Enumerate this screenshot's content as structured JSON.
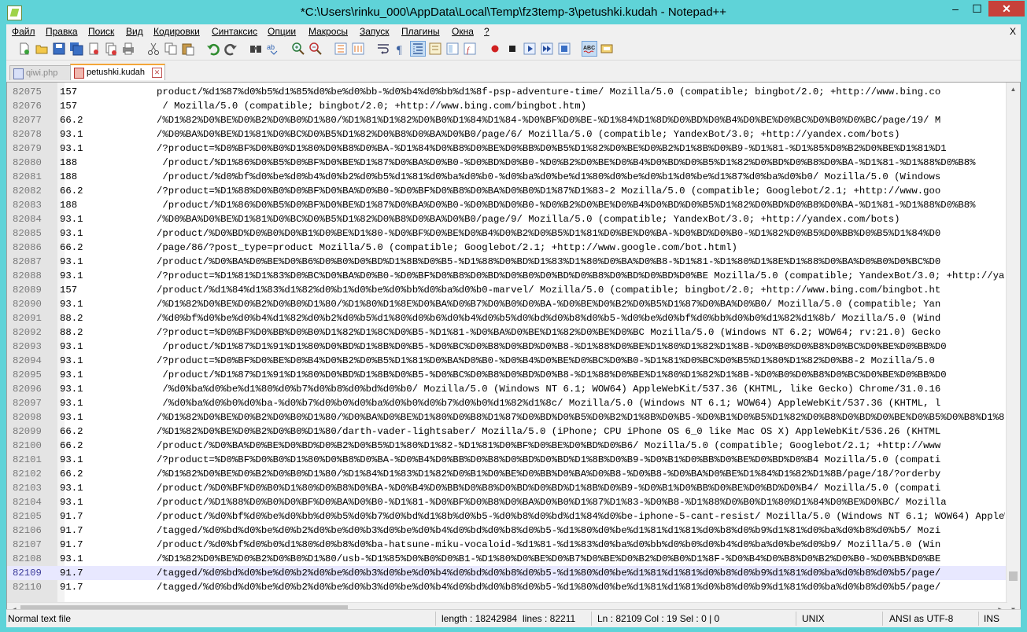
{
  "window": {
    "title": "*C:\\Users\\rinku_000\\AppData\\Local\\Temp\\fz3temp-3\\petushki.kudah - Notepad++",
    "minimize": "–",
    "maximize": "☐",
    "close": "✕"
  },
  "menu": {
    "items": [
      "Файл",
      "Правка",
      "Поиск",
      "Вид",
      "Кодировки",
      "Синтаксис",
      "Опции",
      "Макросы",
      "Запуск",
      "Плагины",
      "Окна",
      "?"
    ],
    "close": "X"
  },
  "tabs": [
    {
      "label": "qiwi.php",
      "active": false
    },
    {
      "label": "petushki.kudah",
      "active": true
    }
  ],
  "editor": {
    "current_line": "82109",
    "lines": [
      {
        "n": "82075",
        "c": "157",
        "t": "product/%d1%87%d0%b5%d1%85%d0%be%d0%bb-%d0%b4%d0%bb%d1%8f-psp-adventure-time/ Mozilla/5.0 (compatible; bingbot/2.0; +http://www.bing.co"
      },
      {
        "n": "82076",
        "c": "157",
        "t": " / Mozilla/5.0 (compatible; bingbot/2.0; +http://www.bing.com/bingbot.htm)"
      },
      {
        "n": "82077",
        "c": "66.2",
        "t": "/%D1%82%D0%BE%D0%B2%D0%B0%D1%80/%D1%81%D1%82%D0%B0%D1%84%D1%84-%D0%BF%D0%BE-%D1%84%D1%8D%D0%BD%D0%B4%D0%BE%D0%BC%D0%B0%D0%BC/page/19/ M"
      },
      {
        "n": "82078",
        "c": "93.1",
        "t": "/%D0%BA%D0%BE%D1%81%D0%BC%D0%B5%D1%82%D0%B8%D0%BA%D0%B0/page/6/ Mozilla/5.0 (compatible; YandexBot/3.0; +http://yandex.com/bots)"
      },
      {
        "n": "82079",
        "c": "93.1",
        "t": "/?product=%D0%BF%D0%B0%D1%80%D0%B8%D0%BA-%D1%84%D0%B8%D0%BE%D0%BB%D0%B5%D1%82%D0%BE%D0%B2%D1%8B%D0%B9-%D1%81-%D1%85%D0%B2%D0%BE%D1%81%D1"
      },
      {
        "n": "82080",
        "c": "188",
        "t": " /product/%D1%86%D0%B5%D0%BF%D0%BE%D1%87%D0%BA%D0%B0-%D0%BD%D0%B0-%D0%B2%D0%BE%D0%B4%D0%BD%D0%B5%D1%82%D0%BD%D0%B8%D0%BA-%D1%81-%D1%88%D0%B8%"
      },
      {
        "n": "82081",
        "c": "188",
        "t": " /product/%d0%bf%d0%be%d0%b4%d0%b2%d0%b5%d1%81%d0%ba%d0%b0-%d0%ba%d0%be%d1%80%d0%be%d0%b1%d0%be%d1%87%d0%ba%d0%b0/ Mozilla/5.0 (Windows"
      },
      {
        "n": "82082",
        "c": "66.2",
        "t": "/?product=%D1%88%D0%B0%D0%BF%D0%BA%D0%B0-%D0%BF%D0%B8%D0%BA%D0%B0%D1%87%D1%83-2 Mozilla/5.0 (compatible; Googlebot/2.1; +http://www.goo"
      },
      {
        "n": "82083",
        "c": "188",
        "t": " /product/%D1%86%D0%B5%D0%BF%D0%BE%D1%87%D0%BA%D0%B0-%D0%BD%D0%B0-%D0%B2%D0%BE%D0%B4%D0%BD%D0%B5%D1%82%D0%BD%D0%B8%D0%BA-%D1%81-%D1%88%D0%B8%"
      },
      {
        "n": "82084",
        "c": "93.1",
        "t": "/%D0%BA%D0%BE%D1%81%D0%BC%D0%B5%D1%82%D0%B8%D0%BA%D0%B0/page/9/ Mozilla/5.0 (compatible; YandexBot/3.0; +http://yandex.com/bots)"
      },
      {
        "n": "82085",
        "c": "93.1",
        "t": "/product/%D0%BD%D0%B0%D0%B1%D0%BE%D1%80-%D0%BF%D0%BE%D0%B4%D0%B2%D0%B5%D1%81%D0%BE%D0%BA-%D0%BD%D0%B0-%D1%82%D0%B5%D0%BB%D0%B5%D1%84%D0"
      },
      {
        "n": "82086",
        "c": "66.2",
        "t": "/page/86/?post_type=product Mozilla/5.0 (compatible; Googlebot/2.1; +http://www.google.com/bot.html)"
      },
      {
        "n": "82087",
        "c": "93.1",
        "t": "/product/%D0%BA%D0%BE%D0%B6%D0%B0%D0%BD%D1%8B%D0%B5-%D1%88%D0%BD%D1%83%D1%80%D0%BA%D0%B8-%D1%81-%D1%80%D1%8E%D1%88%D0%BA%D0%B0%D0%BC%D0"
      },
      {
        "n": "82088",
        "c": "93.1",
        "t": "/?product=%D1%81%D1%83%D0%BC%D0%BA%D0%B0-%D0%BF%D0%B8%D0%BD%D0%B0%D0%BD%D0%B8%D0%BD%D0%BD%D0%BE Mozilla/5.0 (compatible; YandexBot/3.0; +http://yan"
      },
      {
        "n": "82089",
        "c": "157",
        "t": "/product/%d1%84%d1%83%d1%82%d0%b1%d0%be%d0%bb%d0%ba%d0%b0-marvel/ Mozilla/5.0 (compatible; bingbot/2.0; +http://www.bing.com/bingbot.ht"
      },
      {
        "n": "82090",
        "c": "93.1",
        "t": "/%D1%82%D0%BE%D0%B2%D0%B0%D1%80/%D1%80%D1%8E%D0%BA%D0%B7%D0%B0%D0%BA-%D0%BE%D0%B2%D0%B5%D1%87%D0%BA%D0%B0/ Mozilla/5.0 (compatible; Yan"
      },
      {
        "n": "82091",
        "c": "88.2",
        "t": "/%d0%bf%d0%be%d0%b4%d1%82%d0%b2%d0%b5%d1%80%d0%b6%d0%b4%d0%b5%d0%bd%d0%b8%d0%b5-%d0%be%d0%bf%d0%bb%d0%b0%d1%82%d1%8b/ Mozilla/5.0 (Wind"
      },
      {
        "n": "82092",
        "c": "88.2",
        "t": "/?product=%D0%BF%D0%BB%D0%B0%D1%82%D1%8C%D0%B5-%D1%81-%D0%BA%D0%BE%D1%82%D0%BE%D0%BC Mozilla/5.0 (Windows NT 6.2; WOW64; rv:21.0) Gecko"
      },
      {
        "n": "82093",
        "c": "93.1",
        "t": " /product/%D1%87%D1%91%D1%80%D0%BD%D1%8B%D0%B5-%D0%BC%D0%B8%D0%BD%D0%B8-%D1%88%D0%BE%D1%80%D1%82%D1%8B-%D0%B0%D0%B8%D0%BC%D0%BE%D0%BB%D0"
      },
      {
        "n": "82094",
        "c": "93.1",
        "t": "/?product=%D0%BF%D0%BE%D0%B4%D0%B2%D0%B5%D1%81%D0%BA%D0%B0-%D0%B4%D0%BE%D0%BC%D0%B0-%D1%81%D0%BC%D0%B5%D1%80%D1%82%D0%B8-2 Mozilla/5.0"
      },
      {
        "n": "82095",
        "c": "93.1",
        "t": " /product/%D1%87%D1%91%D1%80%D0%BD%D1%8B%D0%B5-%D0%BC%D0%B8%D0%BD%D0%B8-%D1%88%D0%BE%D1%80%D1%82%D1%8B-%D0%B0%D0%B8%D0%BC%D0%BE%D0%BB%D0"
      },
      {
        "n": "82096",
        "c": "93.1",
        "t": " /%d0%ba%d0%be%d1%80%d0%b7%d0%b8%d0%bd%d0%b0/ Mozilla/5.0 (Windows NT 6.1; WOW64) AppleWebKit/537.36 (KHTML, like Gecko) Chrome/31.0.16"
      },
      {
        "n": "82097",
        "c": "93.1",
        "t": " /%d0%ba%d0%b0%d0%ba-%d0%b7%d0%b0%d0%ba%d0%b0%d0%b7%d0%b0%d1%82%d1%8c/ Mozilla/5.0 (Windows NT 6.1; WOW64) AppleWebKit/537.36 (KHTML, l"
      },
      {
        "n": "82098",
        "c": "93.1",
        "t": "/%D1%82%D0%BE%D0%B2%D0%B0%D1%80/%D0%BA%D0%BE%D1%80%D0%B8%D1%87%D0%BD%D0%B5%D0%B2%D1%8B%D0%B5-%D0%B1%D0%B5%D1%82%D0%B8%D0%BD%D0%BE%D0%B5%D0%B8%D1%87"
      },
      {
        "n": "82099",
        "c": "66.2",
        "t": "/%D1%82%D0%BE%D0%B2%D0%B0%D1%80/darth-vader-lightsaber/ Mozilla/5.0 (iPhone; CPU iPhone OS 6_0 like Mac OS X) AppleWebKit/536.26 (KHTML"
      },
      {
        "n": "82100",
        "c": "66.2",
        "t": "/product/%D0%BA%D0%BE%D0%BD%D0%B2%D0%B5%D1%80%D1%82-%D1%81%D0%BF%D0%BE%D0%BD%D0%B6/ Mozilla/5.0 (compatible; Googlebot/2.1; +http://www"
      },
      {
        "n": "82101",
        "c": "93.1",
        "t": "/?product=%D0%BF%D0%B0%D1%80%D0%B8%D0%BA-%D0%B4%D0%BB%D0%B8%D0%BD%D0%BD%D1%8B%D0%B9-%D0%B1%D0%BB%D0%BE%D0%BD%D0%B4 Mozilla/5.0 (compati"
      },
      {
        "n": "82102",
        "c": "66.2",
        "t": "/%D1%82%D0%BE%D0%B2%D0%B0%D1%80/%D1%84%D1%83%D1%82%D0%B1%D0%BE%D0%BB%D0%BA%D0%B8-%D0%B8-%D0%BA%D0%BE%D1%84%D1%82%D1%8B/page/18/?orderby"
      },
      {
        "n": "82103",
        "c": "93.1",
        "t": "/product/%D0%BF%D0%B0%D1%80%D0%B8%D0%BA-%D0%B4%D0%BB%D0%B8%D0%BD%D0%BD%D1%8B%D0%B9-%D0%B1%D0%BB%D0%BE%D0%BD%D0%B4/ Mozilla/5.0 (compati"
      },
      {
        "n": "82104",
        "c": "93.1",
        "t": "/product/%D1%88%D0%B0%D0%BF%D0%BA%D0%B0-%D1%81-%D0%BF%D0%B8%D0%BA%D0%B0%D1%87%D1%83-%D0%B8-%D1%88%D0%B0%D1%80%D1%84%D0%BE%D0%BC/ Mozilla"
      },
      {
        "n": "82105",
        "c": "91.7",
        "t": "/product/%d0%bf%d0%be%d0%bb%d0%b5%d0%b7%d0%bd%d1%8b%d0%b5-%d0%b8%d0%bd%d1%84%d0%be-iphone-5-cant-resist/ Mozilla/5.0 (Windows NT 6.1; WOW64) AppleWebKit/"
      },
      {
        "n": "82106",
        "c": "91.7",
        "t": "/tagged/%d0%bd%d0%be%d0%b2%d0%be%d0%b3%d0%be%d0%b4%d0%bd%d0%b8%d0%b5-%d1%80%d0%be%d1%81%d1%81%d0%b8%d0%b9%d1%81%d0%ba%d0%b8%d0%b5/ Mozi"
      },
      {
        "n": "82107",
        "c": "91.7",
        "t": "/product/%d0%bf%d0%b0%d1%80%d0%b8%d0%ba-hatsune-miku-vocaloid-%d1%81-%d1%83%d0%ba%d0%bb%d0%b0%d0%b4%d0%ba%d0%be%d0%b9/ Mozilla/5.0 (Win"
      },
      {
        "n": "82108",
        "c": "93.1",
        "t": "/%D1%82%D0%BE%D0%B2%D0%B0%D1%80/usb-%D1%85%D0%B0%D0%B1-%D1%80%D0%BE%D0%B7%D0%BE%D0%B2%D0%B0%D1%8F-%D0%B4%D0%B8%D0%B2%D0%B0-%D0%BB%D0%BE"
      },
      {
        "n": "82109",
        "c": "91.7",
        "t": "/tagged/%d0%bd%d0%be%d0%b2%d0%be%d0%b3%d0%be%d0%b4%d0%bd%d0%b8%d0%b5-%d1%80%d0%be%d1%81%d1%81%d0%b8%d0%b9%d1%81%d0%ba%d0%b8%d0%b5/page/"
      },
      {
        "n": "82110",
        "c": "91.7",
        "t": "/tagged/%d0%bd%d0%be%d0%b2%d0%be%d0%b3%d0%be%d0%b4%d0%bd%d0%b8%d0%b5-%d1%80%d0%be%d1%81%d1%81%d0%b8%d0%b9%d1%81%d0%ba%d0%b8%d0%b5/page/"
      }
    ]
  },
  "statusbar": {
    "file_type": "Normal text file",
    "length": "length : 18242984",
    "lines": "lines : 82211",
    "position": "Ln : 82109   Col : 19   Sel : 0 | 0",
    "eol": "UNIX",
    "encoding": "ANSI as UTF-8",
    "mode": "INS"
  }
}
